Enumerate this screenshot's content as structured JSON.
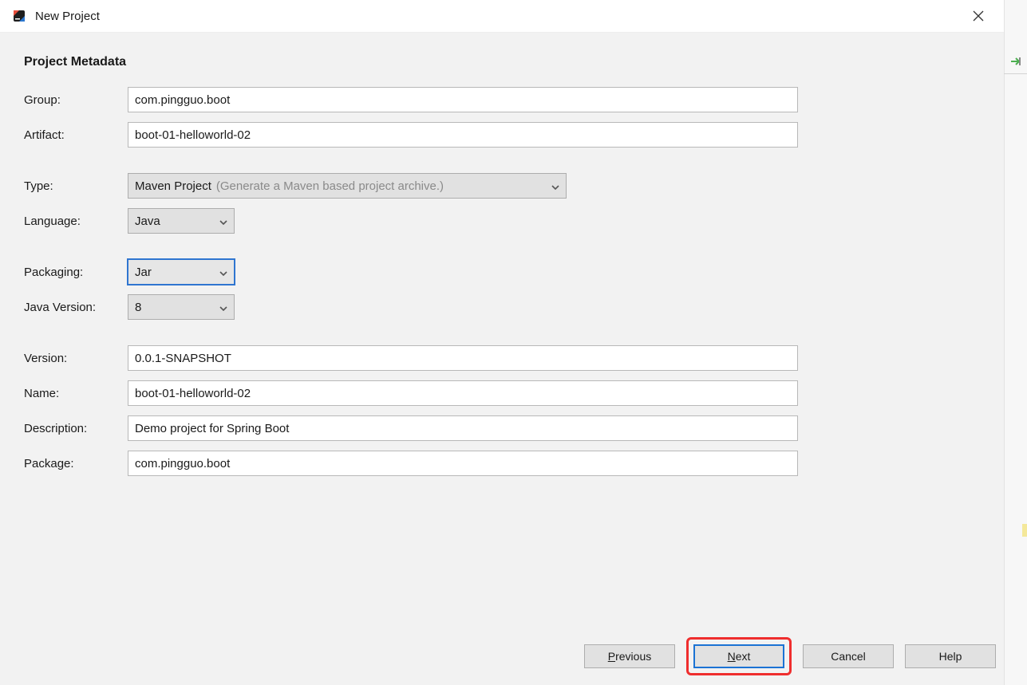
{
  "window": {
    "title": "New Project"
  },
  "section": {
    "heading": "Project Metadata"
  },
  "labels": {
    "group": "Group:",
    "artifact": "Artifact:",
    "type": "Type:",
    "language": "Language:",
    "packaging": "Packaging:",
    "javaVersion": "Java Version:",
    "version": "Version:",
    "name": "Name:",
    "description": "Description:",
    "package": "Package:"
  },
  "fields": {
    "group": "com.pingguo.boot",
    "artifact": "boot-01-helloworld-02",
    "typeValue": "Maven Project",
    "typeHint": "(Generate a Maven based project archive.)",
    "language": "Java",
    "packaging": "Jar",
    "javaVersion": "8",
    "version": "0.0.1-SNAPSHOT",
    "name": "boot-01-helloworld-02",
    "description": "Demo project for Spring Boot",
    "package": "com.pingguo.boot"
  },
  "buttons": {
    "previous_pre": "P",
    "previous_rest": "revious",
    "next_pre": "N",
    "next_rest": "ext",
    "cancel": "Cancel",
    "help": "Help"
  }
}
